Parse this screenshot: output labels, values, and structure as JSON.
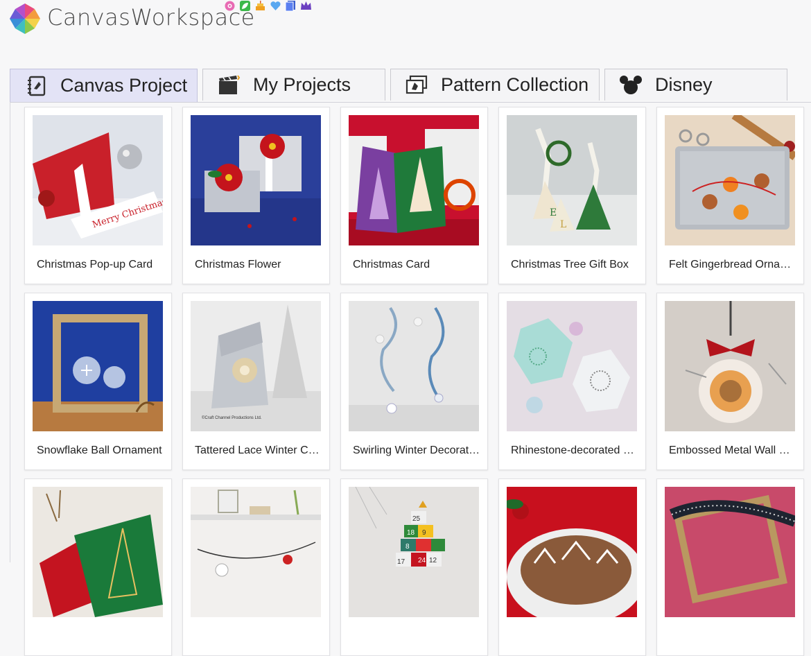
{
  "app": {
    "title": "CanvasWorkspace"
  },
  "tabs": [
    {
      "label": "Canvas Project",
      "icon": "canvas-book-icon",
      "active": true
    },
    {
      "label": "My Projects",
      "icon": "clapperboard-folder-icon",
      "active": false
    },
    {
      "label": "Pattern Collection",
      "icon": "pattern-images-icon",
      "active": false
    },
    {
      "label": "Disney",
      "icon": "mouse-ears-icon",
      "active": false
    }
  ],
  "badges": [
    "flower-badge-icon",
    "leaf-badge-icon",
    "cake-badge-icon",
    "heart-badge-icon",
    "cards-badge-icon",
    "crown-badge-icon"
  ],
  "projects": [
    {
      "title": "Christmas Pop-up Card"
    },
    {
      "title": "Christmas Flower"
    },
    {
      "title": "Christmas Card"
    },
    {
      "title": "Christmas Tree Gift Box"
    },
    {
      "title": "Felt Gingerbread Orna…"
    },
    {
      "title": "Snowflake Ball Ornament"
    },
    {
      "title": "Tattered Lace Winter C…"
    },
    {
      "title": "Swirling Winter Decorat…"
    },
    {
      "title": "Rhinestone-decorated …"
    },
    {
      "title": "Embossed Metal Wall H…"
    },
    {
      "title": ""
    },
    {
      "title": ""
    },
    {
      "title": ""
    },
    {
      "title": ""
    },
    {
      "title": ""
    }
  ],
  "thumb_texts": {
    "merry_christmas": "Merry Christmas",
    "credit": "©Craft Channel Productions Ltd.",
    "calendar_numbers": [
      "25",
      "18",
      "9",
      "8",
      "24",
      "12",
      "17"
    ]
  },
  "colors": {
    "active_tab": "#e3e3f6",
    "tab_border": "#c9c9cf"
  }
}
